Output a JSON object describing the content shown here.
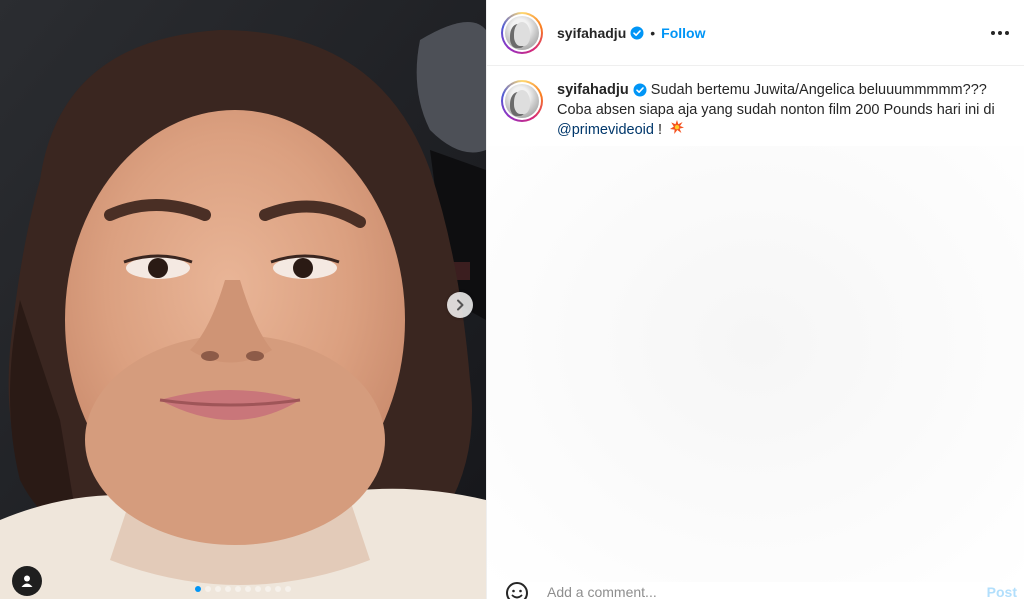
{
  "post": {
    "author": {
      "username": "syifahadju",
      "verified": true,
      "verified_icon": "verified-badge-icon"
    },
    "header": {
      "separator": "•",
      "follow_label": "Follow",
      "more_icon": "more-options-icon"
    },
    "caption": {
      "username": "syifahadju",
      "text_before_mention": " Sudah bertemu Juwita/Angelica beluuummmmm??? Coba absen siapa aja yang sudah nonton film 200 Pounds hari ini di ",
      "mention": "@primevideoid",
      "text_after_mention": " ! ",
      "emoji_icon": "collision-emoji-icon"
    },
    "media": {
      "carousel_total_slides": 10,
      "carousel_active_index": 0,
      "next_icon": "chevron-right-icon",
      "tag_icon": "user-tag-icon",
      "accent_color": "#0095f6"
    },
    "comment_box": {
      "placeholder": "Add a comment...",
      "post_label": "Post",
      "emoji_icon": "emoji-smiley-icon"
    }
  },
  "colors": {
    "link_blue": "#0095f6",
    "mention_blue": "#00376b",
    "text": "#262626",
    "muted": "#8e8e8e"
  }
}
